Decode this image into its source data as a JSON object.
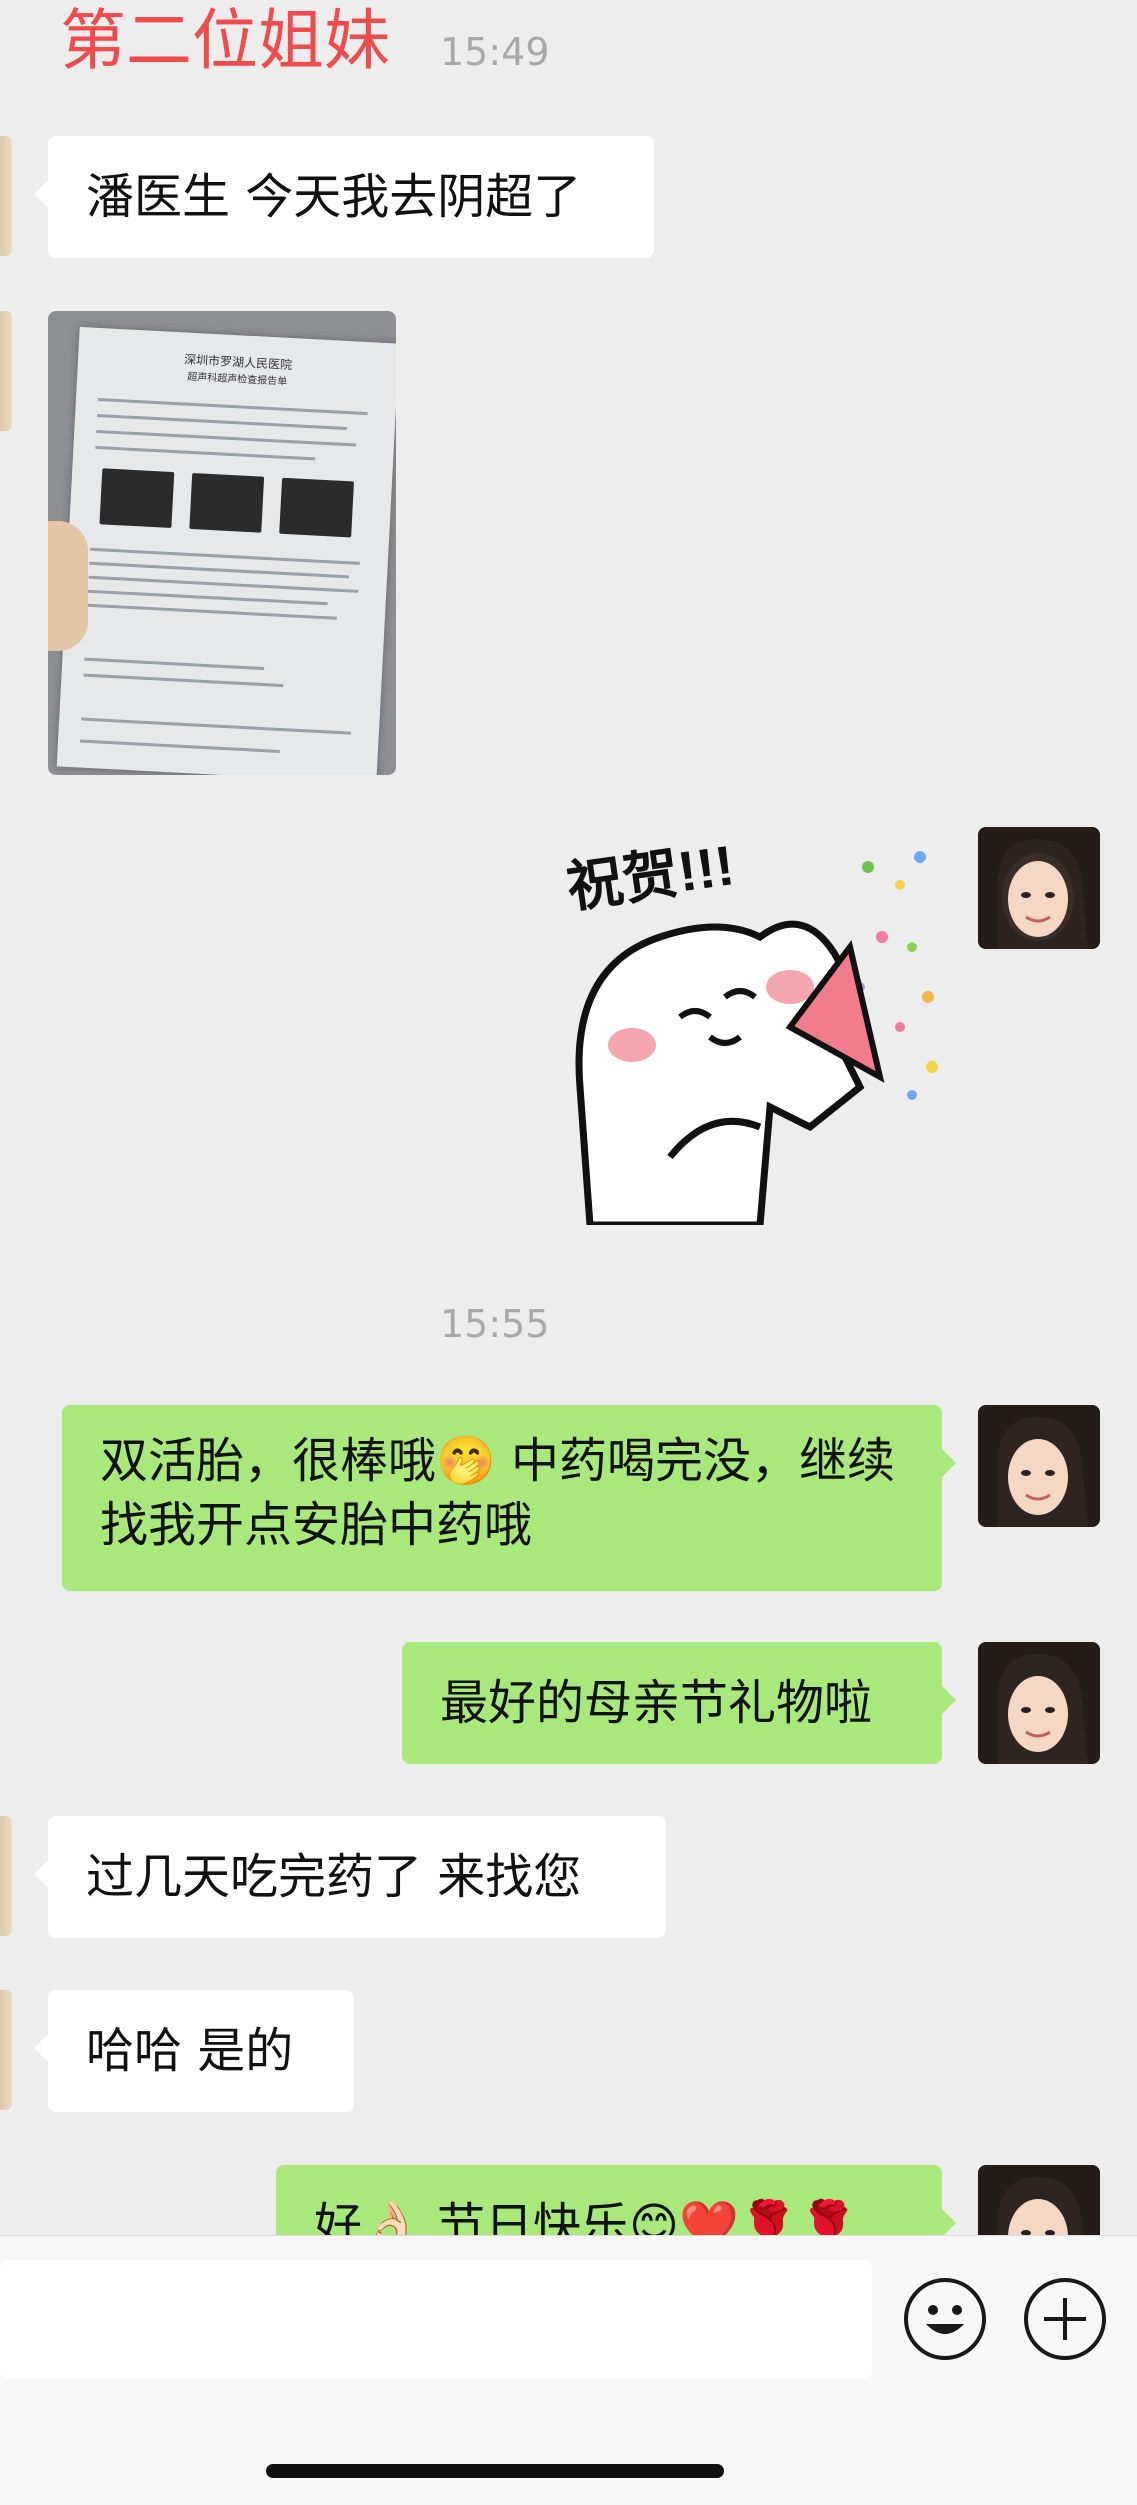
{
  "header": {
    "contact_name": "第二位姐妹",
    "first_time": "15:49"
  },
  "messages": {
    "m1": "潘医生 今天我去阴超了",
    "report_title": "深圳市罗湖人民医院",
    "report_subtitle": "超声科超声检查报告单",
    "sticker_text": "祝贺!!!",
    "second_time": "15:55",
    "m2": "双活胎，很棒哦🤭 中药喝完没，继续找我开点安胎中药哦",
    "m3": "最好的母亲节礼物啦",
    "m4": "过几天吃完药了 来找您",
    "m5": "哈哈 是的",
    "m6": "好👌🏻 节日快乐😊❤️🌹🌹"
  },
  "input_bar": {
    "placeholder": "",
    "emoji_icon": "smiley-icon",
    "plus_icon": "plus-circle-icon"
  },
  "colors": {
    "accent_name": "#f04a4a",
    "outgoing_bubble": "#a9e87a",
    "incoming_bubble": "#ffffff",
    "background": "#ededed"
  }
}
